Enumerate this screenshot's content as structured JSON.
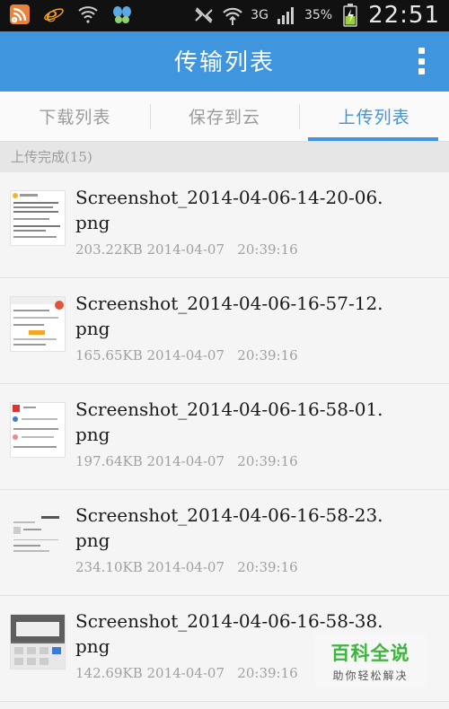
{
  "status_bar": {
    "network": "3G",
    "battery": "35%",
    "time": "22:51"
  },
  "header": {
    "title": "传输列表"
  },
  "tabs": [
    {
      "label": "下载列表",
      "active": false
    },
    {
      "label": "保存到云",
      "active": false
    },
    {
      "label": "上传列表",
      "active": true
    }
  ],
  "section": {
    "label": "上传完成(15)"
  },
  "files": [
    {
      "name": "Screenshot_2014-04-06-14-20-06.png",
      "size": "203.22KB",
      "date": "2014-04-07",
      "time": "20:39:16"
    },
    {
      "name": "Screenshot_2014-04-06-16-57-12.png",
      "size": "165.65KB",
      "date": "2014-04-07",
      "time": "20:39:16"
    },
    {
      "name": "Screenshot_2014-04-06-16-58-01.png",
      "size": "197.64KB",
      "date": "2014-04-07",
      "time": "20:39:16"
    },
    {
      "name": "Screenshot_2014-04-06-16-58-23.png",
      "size": "234.10KB",
      "date": "2014-04-07",
      "time": "20:39:16"
    },
    {
      "name": "Screenshot_2014-04-06-16-58-38.png",
      "size": "142.69KB",
      "date": "2014-04-07",
      "time": "20:39:16"
    }
  ],
  "watermark": {
    "title": "百科全说",
    "subtitle": "助你轻松解决"
  }
}
